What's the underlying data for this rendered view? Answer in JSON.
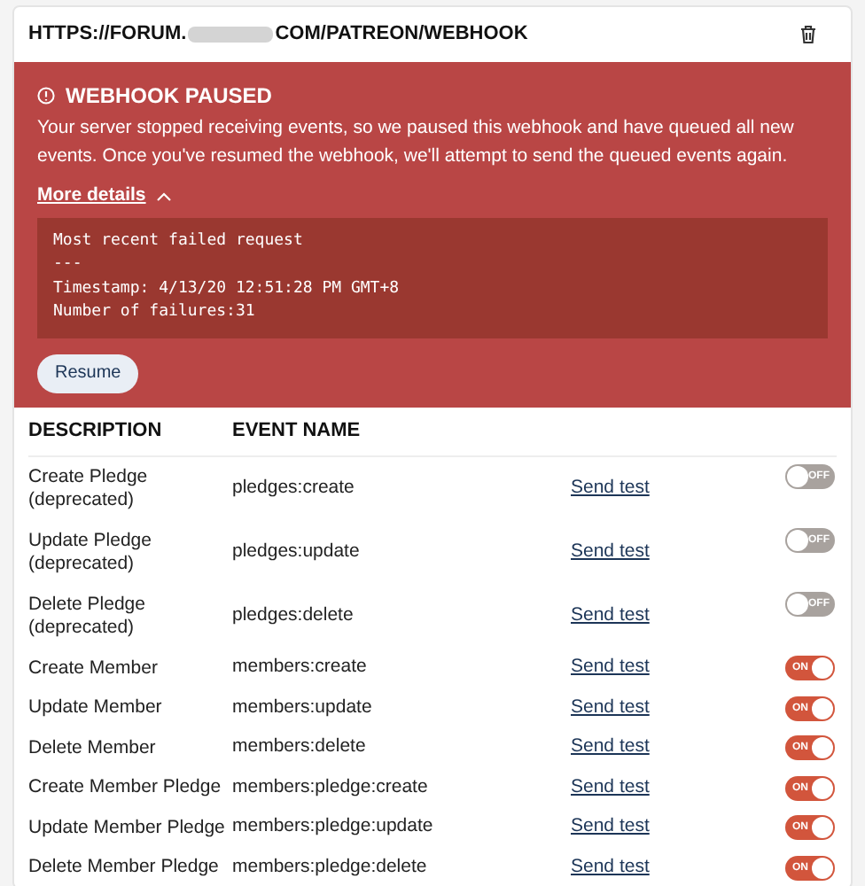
{
  "webhook": {
    "url_start": "HTTPS://FORUM.",
    "url_end": "COM/PATREON/WEBHOOK"
  },
  "alert": {
    "title": "WEBHOOK PAUSED",
    "message": "Your server stopped receiving events, so we paused this webhook and have queued all new events. Once you've resumed the webhook, we'll attempt to send the queued events again.",
    "details_link": "More details",
    "details_expanded": true,
    "details": [
      "Most recent failed request",
      "---",
      "Timestamp: 4/13/20 12:51:28 PM GMT+8",
      "Number of failures:31"
    ],
    "button": "Resume"
  },
  "table": {
    "columns": [
      "DESCRIPTION",
      "EVENT NAME"
    ],
    "rows": [
      {
        "description": "Create Pledge (deprecated)",
        "event": "pledges:create",
        "action": "Send test",
        "on": false,
        "toggle_label": "OFF"
      },
      {
        "description": "Update Pledge (deprecated)",
        "event": "pledges:update",
        "action": "Send test",
        "on": false,
        "toggle_label": "OFF"
      },
      {
        "description": "Delete Pledge (deprecated)",
        "event": "pledges:delete",
        "action": "Send test",
        "on": false,
        "toggle_label": "OFF"
      },
      {
        "description": "Create Member",
        "event": "members:create",
        "action": "Send test",
        "on": true,
        "toggle_label": "ON"
      },
      {
        "description": "Update Member",
        "event": "members:update",
        "action": "Send test",
        "on": true,
        "toggle_label": "ON"
      },
      {
        "description": "Delete Member",
        "event": "members:delete",
        "action": "Send test",
        "on": true,
        "toggle_label": "ON"
      },
      {
        "description": "Create Member Pledge",
        "event": "members:pledge:create",
        "action": "Send test",
        "on": true,
        "toggle_label": "ON"
      },
      {
        "description": "Update Member Pledge",
        "event": "members:pledge:update",
        "action": "Send test",
        "on": true,
        "toggle_label": "ON"
      },
      {
        "description": "Delete Member Pledge",
        "event": "members:pledge:delete",
        "action": "Send test",
        "on": true,
        "toggle_label": "ON"
      }
    ]
  }
}
